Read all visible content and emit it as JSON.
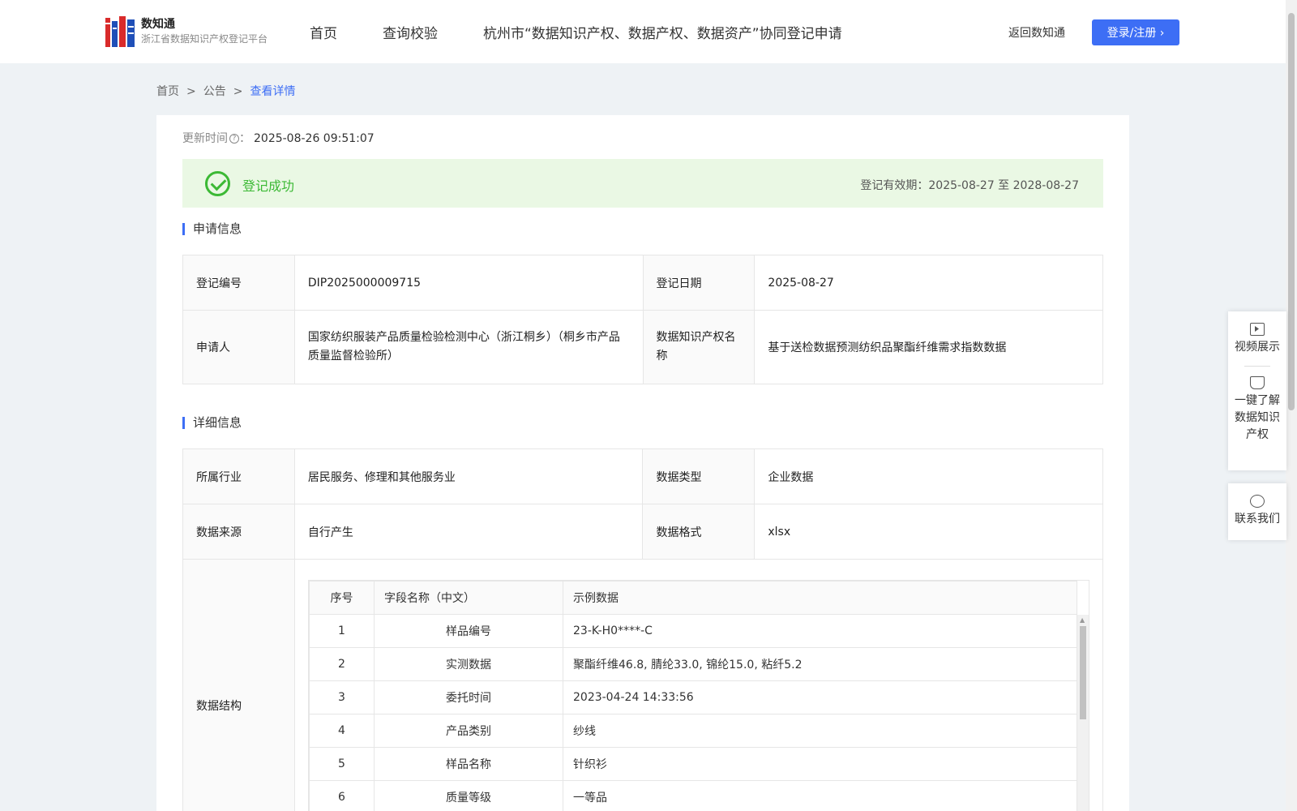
{
  "header": {
    "logo_title": "数知通",
    "logo_subtitle": "浙江省数据知识产权登记平台",
    "nav": [
      "首页",
      "查询校验",
      "杭州市“数据知识产权、数据产权、数据资产”协同登记申请"
    ],
    "back_link": "返回数知通",
    "login_label": "登录/注册 ›"
  },
  "breadcrumb": {
    "home": "首页",
    "sep": ">",
    "notice": "公告",
    "current": "查看详情"
  },
  "update": {
    "label": "更新时间",
    "help": "?",
    "colon": "：",
    "value": "2025-08-26 09:51:07"
  },
  "status": {
    "text": "登记成功",
    "validity": "登记有效期：2025-08-27 至 2028-08-27"
  },
  "application": {
    "title": "申请信息",
    "reg_no_label": "登记编号",
    "reg_no": "DIP2025000009715",
    "reg_date_label": "登记日期",
    "reg_date": "2025-08-27",
    "applicant_label": "申请人",
    "applicant": "国家纺织服装产品质量检验检测中心（浙江桐乡）（桐乡市产品质量监督检验所）",
    "ip_name_label": "数据知识产权名称",
    "ip_name": "基于送检数据预测纺织品聚酯纤维需求指数数据"
  },
  "detail": {
    "title": "详细信息",
    "industry_label": "所属行业",
    "industry": "居民服务、修理和其他服务业",
    "type_label": "数据类型",
    "type": "企业数据",
    "source_label": "数据来源",
    "source": "自行产生",
    "format_label": "数据格式",
    "format": "xlsx",
    "structure_label": "数据结构"
  },
  "structure": {
    "headers": [
      "序号",
      "字段名称（中文）",
      "示例数据"
    ],
    "rows": [
      [
        "1",
        "样品编号",
        "23-K-H0****-C"
      ],
      [
        "2",
        "实测数据",
        "聚酯纤维46.8, 腈纶33.0, 锦纶15.0, 粘纤5.2"
      ],
      [
        "3",
        "委托时间",
        "2023-04-24 14:33:56"
      ],
      [
        "4",
        "产品类别",
        "纱线"
      ],
      [
        "5",
        "样品名称",
        "针织衫"
      ],
      [
        "6",
        "质量等级",
        "一等品"
      ]
    ]
  },
  "float_panel": {
    "video": "视频展示",
    "learn_line1": "一键了解",
    "learn_line2": "数据知识",
    "learn_line3": "产权",
    "contact": "联系我们"
  },
  "colors": {
    "accent": "#3d6ef5",
    "success": "#3cb935",
    "success_bg": "#eaf8e4"
  }
}
